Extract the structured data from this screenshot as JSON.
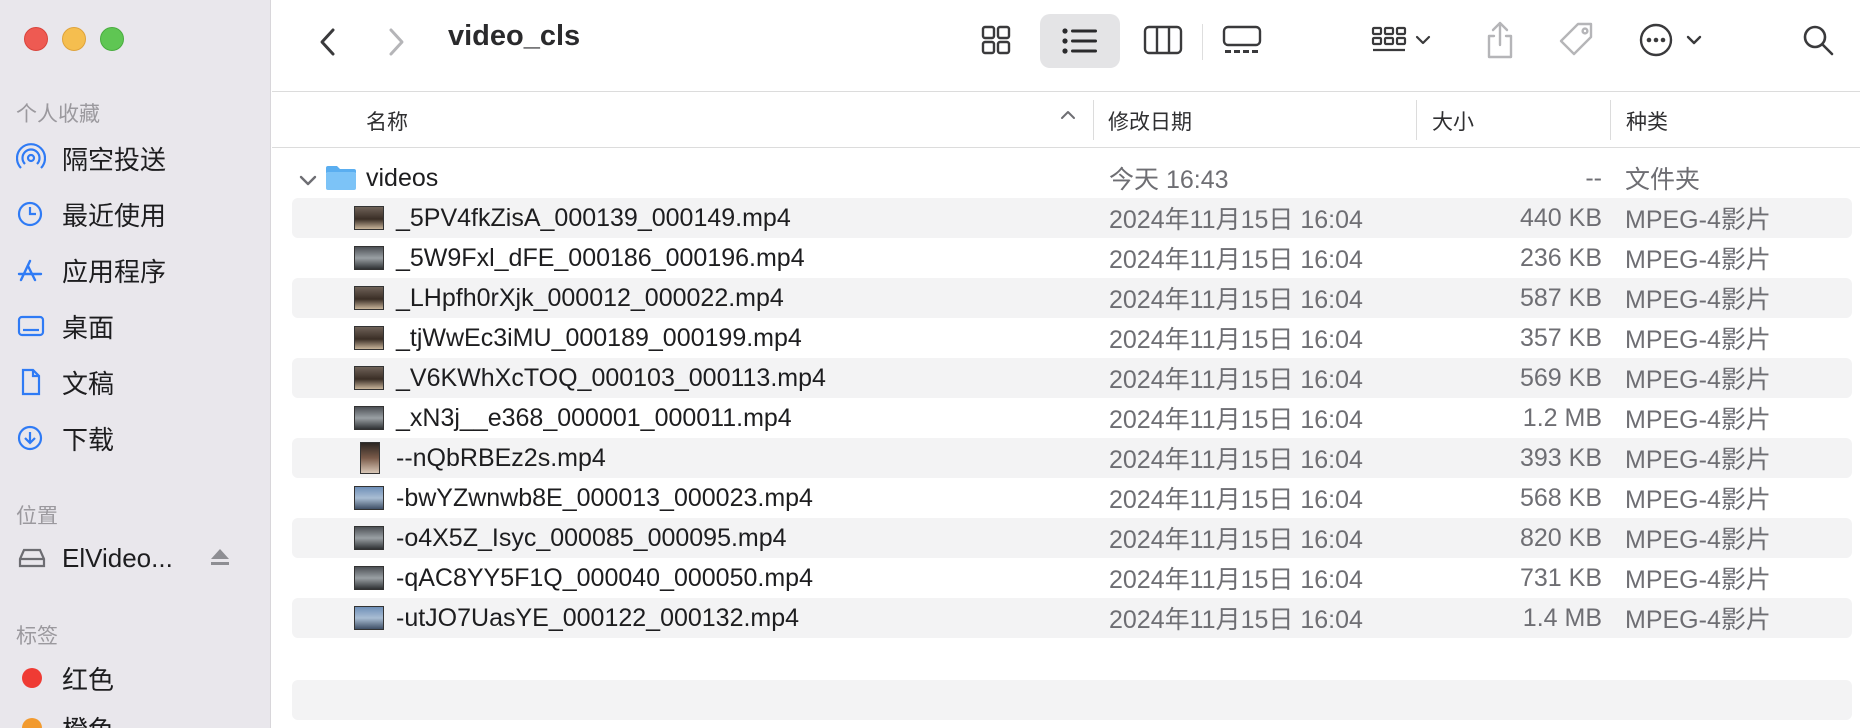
{
  "window": {
    "title": "video_cls"
  },
  "sidebar": {
    "favorites_title": "个人收藏",
    "favorites": [
      {
        "label": "隔空投送",
        "icon": "airdrop-icon"
      },
      {
        "label": "最近使用",
        "icon": "clock-icon"
      },
      {
        "label": "应用程序",
        "icon": "applications-icon"
      },
      {
        "label": "桌面",
        "icon": "desktop-icon"
      },
      {
        "label": "文稿",
        "icon": "document-icon"
      },
      {
        "label": "下载",
        "icon": "download-icon"
      }
    ],
    "locations_title": "位置",
    "locations": [
      {
        "label": "ElVideo...",
        "icon": "drive-icon"
      }
    ],
    "tags_title": "标签",
    "tags": [
      {
        "label": "红色",
        "color": "#ef3b34"
      },
      {
        "label": "橙色",
        "color": "#f29a2e"
      }
    ]
  },
  "columns": {
    "name": "名称",
    "date": "修改日期",
    "size": "大小",
    "kind": "种类"
  },
  "folder": {
    "name": "videos",
    "date": "今天 16:43",
    "size": "--",
    "kind": "文件夹"
  },
  "files": [
    {
      "name": "_5PV4fkZisA_000139_000149.mp4",
      "date": "2024年11月15日 16:04",
      "size": "440 KB",
      "kind": "MPEG-4影片"
    },
    {
      "name": "_5W9Fxl_dFE_000186_000196.mp4",
      "date": "2024年11月15日 16:04",
      "size": "236 KB",
      "kind": "MPEG-4影片"
    },
    {
      "name": "_LHpfh0rXjk_000012_000022.mp4",
      "date": "2024年11月15日 16:04",
      "size": "587 KB",
      "kind": "MPEG-4影片"
    },
    {
      "name": "_tjWwEc3iMU_000189_000199.mp4",
      "date": "2024年11月15日 16:04",
      "size": "357 KB",
      "kind": "MPEG-4影片"
    },
    {
      "name": "_V6KWhXcTOQ_000103_000113.mp4",
      "date": "2024年11月15日 16:04",
      "size": "569 KB",
      "kind": "MPEG-4影片"
    },
    {
      "name": "_xN3j__e368_000001_000011.mp4",
      "date": "2024年11月15日 16:04",
      "size": "1.2 MB",
      "kind": "MPEG-4影片"
    },
    {
      "name": "--nQbRBEz2s.mp4",
      "date": "2024年11月15日 16:04",
      "size": "393 KB",
      "kind": "MPEG-4影片"
    },
    {
      "name": "-bwYZwnwb8E_000013_000023.mp4",
      "date": "2024年11月15日 16:04",
      "size": "568 KB",
      "kind": "MPEG-4影片"
    },
    {
      "name": "-o4X5Z_Isyc_000085_000095.mp4",
      "date": "2024年11月15日 16:04",
      "size": "820 KB",
      "kind": "MPEG-4影片"
    },
    {
      "name": "-qAC8YY5F1Q_000040_000050.mp4",
      "date": "2024年11月15日 16:04",
      "size": "731 KB",
      "kind": "MPEG-4影片"
    },
    {
      "name": "-utJO7UasYE_000122_000132.mp4",
      "date": "2024年11月15日 16:04",
      "size": "1.4 MB",
      "kind": "MPEG-4影片"
    }
  ],
  "toolbar": {
    "icons": [
      "back-icon",
      "forward-icon",
      "grid-view-icon",
      "list-view-icon",
      "column-view-icon",
      "gallery-view-icon",
      "group-icon",
      "share-icon",
      "tag-icon",
      "more-icon",
      "search-icon"
    ],
    "active_view": "list"
  }
}
